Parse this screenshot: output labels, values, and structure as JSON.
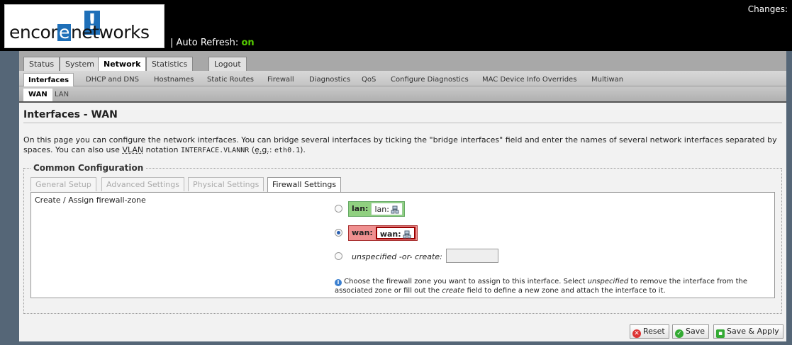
{
  "header": {
    "logo_text_a": "encor",
    "logo_e": "e",
    "logo_text_b": "networks",
    "auto_refresh_label": "| Auto Refresh:",
    "auto_refresh_value": "on",
    "changes_label": "Changes:"
  },
  "main_tabs": [
    "Status",
    "System",
    "Network",
    "Statistics",
    "Logout"
  ],
  "sub_tabs": [
    "Interfaces",
    "DHCP and DNS",
    "Hostnames",
    "Static Routes",
    "Firewall",
    "Diagnostics",
    "QoS",
    "Configure Diagnostics",
    "MAC Device Info Overrides",
    "Multiwan"
  ],
  "subsub_tabs": [
    "WAN",
    "LAN"
  ],
  "page": {
    "title": "Interfaces - WAN",
    "desc_1": "On this page you can configure the network interfaces. You can bridge several interfaces by ticking the \"bridge interfaces\" field and enter the names of several network interfaces separated by spaces. You can also use ",
    "desc_vlan": "VLAN",
    "desc_2": " notation ",
    "desc_code1": "INTERFACE.VLANNR",
    "desc_3": " (",
    "desc_eg": "e.g.",
    "desc_4": ": ",
    "desc_code2": "eth0.1",
    "desc_5": ")."
  },
  "section": {
    "legend": "Common Configuration",
    "tabs": [
      "General Setup",
      "Advanced Settings",
      "Physical Settings",
      "Firewall Settings"
    ],
    "field_label": "Create / Assign firewall-zone",
    "zones": [
      {
        "name": "lan:",
        "iface": "lan:",
        "checked": false
      },
      {
        "name": "wan:",
        "iface": "wan:",
        "checked": true
      }
    ],
    "create_label": "unspecified -or- create:",
    "create_value": "",
    "help_1": " Choose the firewall zone you want to assign to this interface. Select ",
    "help_unspec": "unspecified",
    "help_2": " to remove the interface from the associated zone or fill out the ",
    "help_create": "create",
    "help_3": " field to define a new zone and attach the interface to it."
  },
  "buttons": {
    "reset": "Reset",
    "save": "Save",
    "save_apply": "Save & Apply"
  },
  "colors": {
    "accent": "#1e6fb8",
    "lan_zone": "#90d080",
    "wan_zone": "#f09090",
    "auto_refresh_on": "#55cc00"
  }
}
